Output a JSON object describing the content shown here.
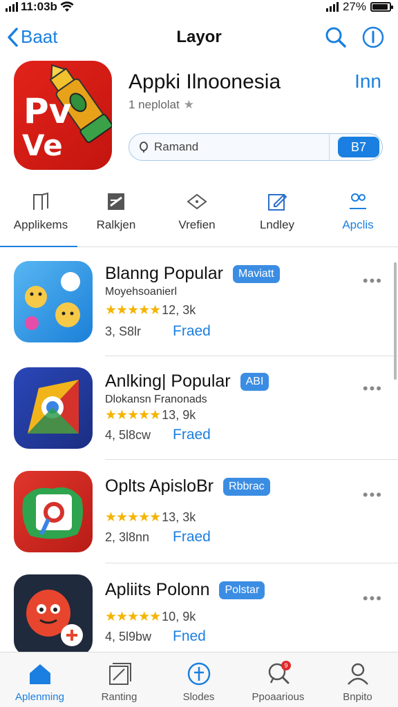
{
  "status": {
    "time": "11:03b",
    "battery": "27%"
  },
  "nav": {
    "back_label": "Baat",
    "title": "Layor"
  },
  "app": {
    "icon_text_top": "Pv",
    "icon_text_bottom": "Ve",
    "name": "Appki Ilnoonesia",
    "subtitle": "1 neplolat",
    "get_label": "Inn",
    "search_value": "Ramand",
    "search_chip": "B7"
  },
  "categories": [
    {
      "label": "Applikems",
      "icon": "bookmark-icon"
    },
    {
      "label": "Ralkjen",
      "icon": "flag-icon"
    },
    {
      "label": "Vrefien",
      "icon": "diamond-icon"
    },
    {
      "label": "Lndley",
      "icon": "edit-icon"
    },
    {
      "label": "Apclis",
      "icon": "people-icon"
    }
  ],
  "list": [
    {
      "title": "Blanng Popular",
      "badge": "Maviatt",
      "developer": "Moyehsoanierl",
      "stars": "★★★★★",
      "rating": "12, 3k",
      "size": "3, S8lr",
      "price": "Fraed"
    },
    {
      "title": "Anlking| Popular",
      "badge": "ABI",
      "developer": "Dlokansn Franonads",
      "stars": "★★★★★",
      "rating": "13, 9k",
      "size": "4, 5l8cw",
      "price": "Fraed"
    },
    {
      "title": "Oplts ApisloBr",
      "badge": "Rbbrac",
      "developer": "",
      "stars": "★★★★★",
      "rating": "13, 3k",
      "size": "2, 3l8nn",
      "price": "Fraed"
    },
    {
      "title": "Apliits Polonn",
      "badge": "Polstar",
      "developer": "",
      "stars": "★★★★★",
      "rating": "10, 9k",
      "size": "4, 5l9bw",
      "price": "Fned"
    }
  ],
  "tabbar": [
    {
      "label": "Aplenming",
      "icon": "home-icon"
    },
    {
      "label": "Ranting",
      "icon": "stack-icon"
    },
    {
      "label": "Slodes",
      "icon": "compass-icon"
    },
    {
      "label": "Ppoaarious",
      "icon": "search-icon",
      "badge": "9"
    },
    {
      "label": "Bnpito",
      "icon": "profile-icon"
    }
  ],
  "colors": {
    "accent": "#1a7fe0",
    "badge": "#3b8de3",
    "star": "#f5b400"
  }
}
